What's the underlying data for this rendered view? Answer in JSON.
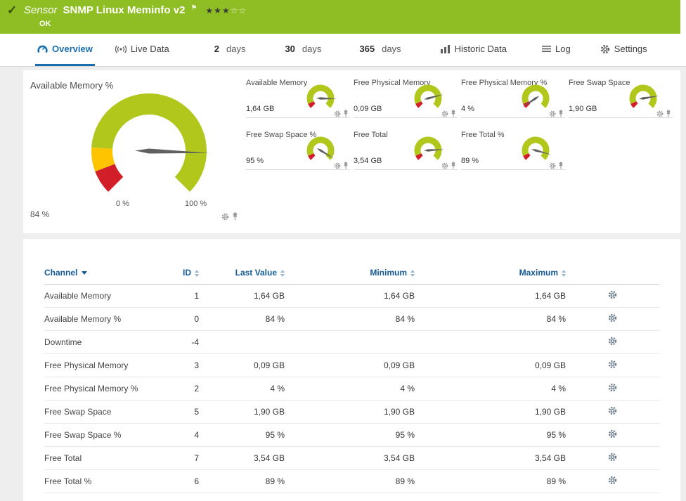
{
  "colors": {
    "header_green": "#8ebe23",
    "accent_blue": "#1b6eae",
    "table_header_blue": "#135a96",
    "gauge_ok": "#b2c71c",
    "gauge_warn": "#ffc400",
    "gauge_error": "#d21e28",
    "gauge_needle": "#606060"
  },
  "header": {
    "check_icon": "✓",
    "kind_label": "Sensor",
    "title": "SNMP Linux Meminfo v2",
    "flag_icon": "⚑",
    "stars_filled": "★★★",
    "stars_empty": "☆☆",
    "status": "OK"
  },
  "tabs": {
    "overview": {
      "label": "Overview"
    },
    "live_data": {
      "label": "Live Data"
    },
    "days2": {
      "num": "2",
      "label": "days"
    },
    "days30": {
      "num": "30",
      "label": "days"
    },
    "days365": {
      "num": "365",
      "label": "days"
    },
    "historic": {
      "label": "Historic Data"
    },
    "log": {
      "label": "Log"
    },
    "settings": {
      "label": "Settings"
    }
  },
  "main_gauge": {
    "title": "Available Memory %",
    "value_label": "84 %",
    "percent": 84,
    "scale_min": "0 %",
    "scale_max": "100 %",
    "segments": [
      {
        "from": 0,
        "to": 9,
        "color": "error"
      },
      {
        "from": 9,
        "to": 18,
        "color": "warn"
      },
      {
        "from": 18,
        "to": 100,
        "color": "ok"
      }
    ]
  },
  "mini_segments": [
    {
      "from": 0,
      "to": 8,
      "color": "error"
    },
    {
      "from": 8,
      "to": 100,
      "color": "ok"
    }
  ],
  "mini_gauges": [
    {
      "title": "Available Memory",
      "value": "1,64 GB",
      "percent": 84
    },
    {
      "title": "Free Physical Memory",
      "value": "0,09 GB",
      "percent": 78
    },
    {
      "title": "Free Physical Memory %",
      "value": "4 %",
      "percent": 4
    },
    {
      "title": "Free Swap Space",
      "value": "1,90 GB",
      "percent": 80
    },
    {
      "title": "Free Swap Space %",
      "value": "95 %",
      "percent": 95
    },
    {
      "title": "Free Total",
      "value": "3,54 GB",
      "percent": 82
    },
    {
      "title": "Free Total %",
      "value": "89 %",
      "percent": 89
    }
  ],
  "table": {
    "columns": {
      "channel": "Channel",
      "id": "ID",
      "last_value": "Last Value",
      "minimum": "Minimum",
      "maximum": "Maximum"
    },
    "rows": [
      {
        "channel": "Available Memory",
        "id": "1",
        "last": "1,64 GB",
        "min": "1,64 GB",
        "max": "1,64 GB"
      },
      {
        "channel": "Available Memory %",
        "id": "0",
        "last": "84 %",
        "min": "84 %",
        "max": "84 %"
      },
      {
        "channel": "Downtime",
        "id": "-4",
        "last": "",
        "min": "",
        "max": ""
      },
      {
        "channel": "Free Physical Memory",
        "id": "3",
        "last": "0,09 GB",
        "min": "0,09 GB",
        "max": "0,09 GB"
      },
      {
        "channel": "Free Physical Memory %",
        "id": "2",
        "last": "4 %",
        "min": "4 %",
        "max": "4 %"
      },
      {
        "channel": "Free Swap Space",
        "id": "5",
        "last": "1,90 GB",
        "min": "1,90 GB",
        "max": "1,90 GB"
      },
      {
        "channel": "Free Swap Space %",
        "id": "4",
        "last": "95 %",
        "min": "95 %",
        "max": "95 %"
      },
      {
        "channel": "Free Total",
        "id": "7",
        "last": "3,54 GB",
        "min": "3,54 GB",
        "max": "3,54 GB"
      },
      {
        "channel": "Free Total %",
        "id": "6",
        "last": "89 %",
        "min": "89 %",
        "max": "89 %"
      }
    ]
  }
}
